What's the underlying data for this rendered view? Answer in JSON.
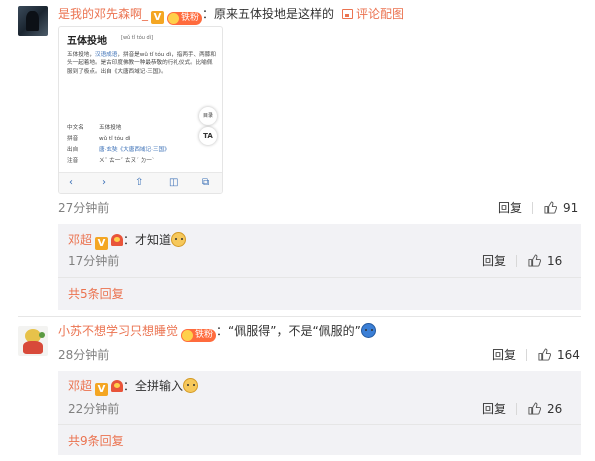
{
  "comments": [
    {
      "username": "是我的邓先森啊_",
      "vip_badge": "V",
      "fan_badge": "铁粉",
      "text": "：原来五体投地是这样的",
      "pic_link": "评论配图",
      "time": "27分钟前",
      "reply_label": "回复",
      "likes": "91",
      "screenshot": {
        "title": "五体投地",
        "pinyin": "[wǔ tǐ tóu dì]",
        "body_pre": "五体投地，",
        "body_link": "汉语成语",
        "body_post": "，拼音是wǔ tǐ tóu dì，指两手、两膝和头一起着地。是古印度佛教一种最恭敬的行礼仪式。比喻佩服到了极点。出自《大唐西域记·三国》。",
        "rows": [
          {
            "k": "中文名",
            "v": "五体投地"
          },
          {
            "k": "拼音",
            "v": "wǔ tǐ tóu dì"
          },
          {
            "k": "出自",
            "v": "唐·玄奘《大唐西域记·三国》"
          },
          {
            "k": "注音",
            "v": "ㄨˇ ㄊ一ˇ ㄊㄡˊ ㄉ一ˋ"
          }
        ],
        "fab1": "目录",
        "fab2": "TA",
        "nav": [
          "‹",
          "›",
          "⇧",
          "◫",
          "⧉"
        ]
      },
      "reply": {
        "username": "邓超",
        "vip_badge": "V",
        "text": "：才知道",
        "time": "17分钟前",
        "reply_label": "回复",
        "likes": "16",
        "more": "共5条回复"
      }
    },
    {
      "username": "小苏不想学习只想睡觉",
      "fan_badge": "铁粉",
      "text": "：“佩服得”，不是“佩服的”",
      "time": "28分钟前",
      "reply_label": "回复",
      "likes": "164",
      "reply": {
        "username": "邓超",
        "vip_badge": "V",
        "text": "：全拼输入",
        "time": "22分钟前",
        "reply_label": "回复",
        "likes": "26",
        "more": "共9条回复"
      }
    }
  ],
  "colors": {
    "link": "#eb7350",
    "vip": "#f4a623",
    "reply_bg": "#f2f2f5"
  }
}
